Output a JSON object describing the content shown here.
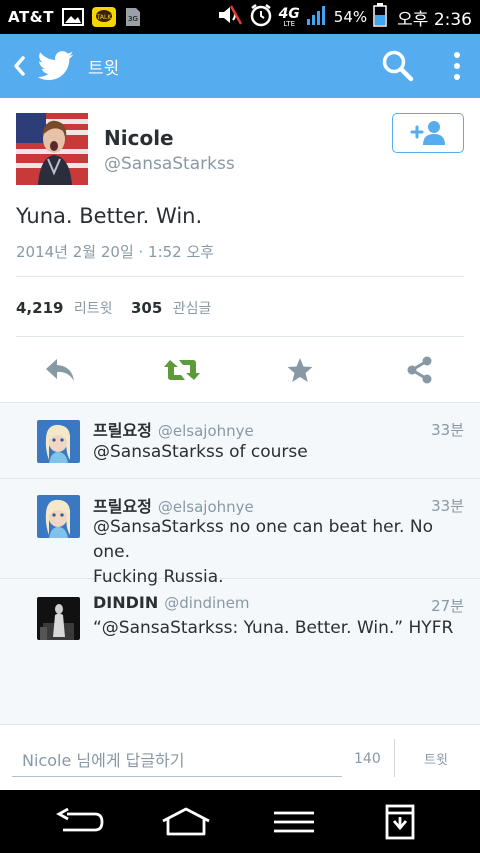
{
  "status_bar": {
    "carrier": "AT&T",
    "network": "4G",
    "network_sub": "LTE",
    "battery": "54%",
    "time": "오후 2:36",
    "icons": [
      "image-icon",
      "kakaotalk-icon",
      "sim-icon",
      "mute-icon",
      "alarm-icon",
      "signal-icon",
      "battery-icon"
    ]
  },
  "app_bar": {
    "title": "트윗",
    "color": "#55acee"
  },
  "tweet": {
    "name": "Nicole",
    "handle": "@SansaStarkss",
    "text": "Yuna. Better. Win.",
    "timestamp": "2014년 2월 20일 · 1:52 오후",
    "retweets_count": "4,219",
    "retweets_label": "리트윗",
    "favorites_count": "305",
    "favorites_label": "관심글",
    "actions": [
      "reply-icon",
      "retweet-icon",
      "favorite-icon",
      "share-icon"
    ],
    "retweet_color": "#5c9a3a"
  },
  "replies": [
    {
      "name": "프릴요정",
      "handle": "@elsajohnye",
      "time": "33분",
      "text": "@SansaStarkss of course"
    },
    {
      "name": "프릴요정",
      "handle": "@elsajohnye",
      "time": "33분",
      "text_line1": "@SansaStarkss no one can beat her. No one.",
      "text_line2": "Fucking Russia."
    },
    {
      "name": "DINDIN",
      "handle": "@dindinem",
      "time": "27분",
      "text": "“@SansaStarkss: Yuna. Better. Win.” HYFR"
    }
  ],
  "compose": {
    "placeholder": "Nicole 님에게 답글하기",
    "char_count": "140",
    "send_label": "트윗"
  },
  "nav_bar": {
    "buttons": [
      "back-icon",
      "home-icon",
      "menu-icon",
      "download-icon"
    ]
  }
}
